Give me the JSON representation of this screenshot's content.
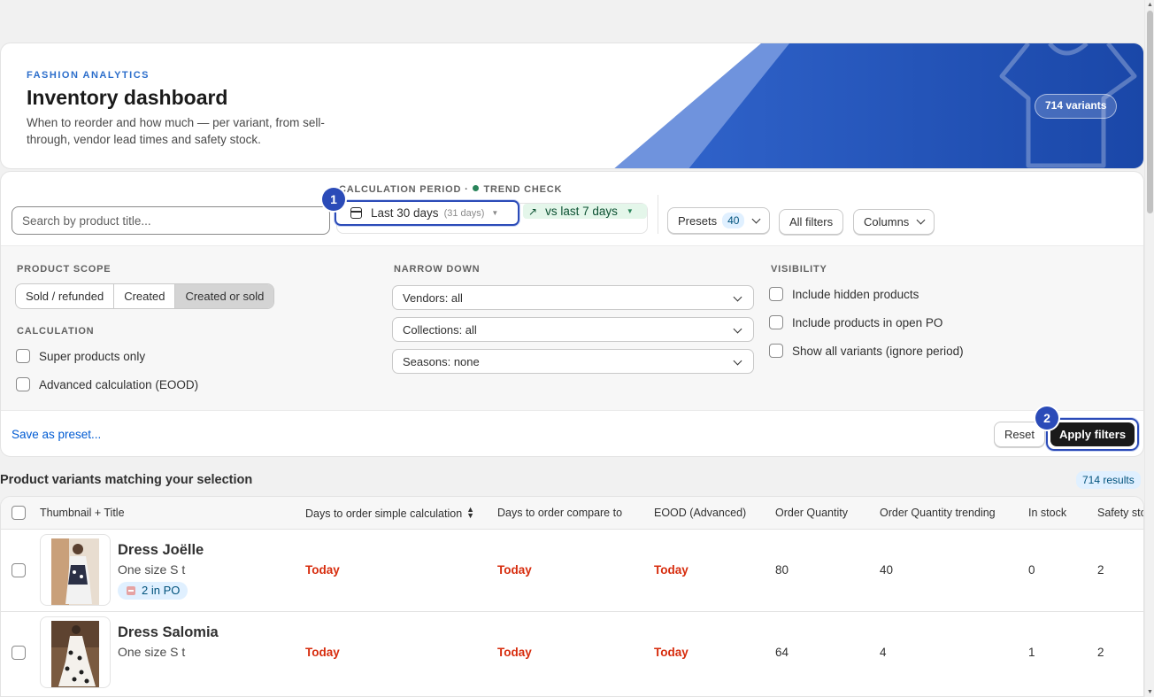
{
  "hero": {
    "eyebrow": "FASHION ANALYTICS",
    "title": "Inventory dashboard",
    "description": "When to reorder and how much — per variant, from sell-through, vendor lead times and safety stock.",
    "variants_pill": "714 variants"
  },
  "toolbar": {
    "search_placeholder": "Search by product title...",
    "calc_label": "CALCULATION PERIOD",
    "calc_separator": "·",
    "trend_label": "TREND CHECK",
    "period": "Last 30 days",
    "period_days": "(31 days)",
    "trend": "vs last 7 days",
    "presets_label": "Presets",
    "presets_count": "40",
    "all_filters": "All filters",
    "columns": "Columns"
  },
  "step_badges": {
    "one": "1",
    "two": "2"
  },
  "filters": {
    "product_scope_label": "PRODUCT SCOPE",
    "scope_options": [
      "Sold / refunded",
      "Created",
      "Created or sold"
    ],
    "scope_selected": "Created or sold",
    "calculation_label": "CALCULATION",
    "calc_options": [
      "Super products only",
      "Advanced calculation (EOOD)"
    ],
    "narrow_label": "NARROW DOWN",
    "vendors": "Vendors: all",
    "collections": "Collections: all",
    "seasons": "Seasons: none",
    "visibility_label": "VISIBILITY",
    "visibility_options": [
      "Include hidden products",
      "Include products in open PO",
      "Show all variants (ignore period)"
    ]
  },
  "actions": {
    "save_preset": "Save as preset...",
    "reset": "Reset",
    "apply": "Apply filters"
  },
  "results": {
    "title": "Product variants matching your selection",
    "count": "714 results",
    "columns": [
      "Thumbnail + Title",
      "Days to order simple calculation",
      "Days to order compare to",
      "EOOD (Advanced)",
      "Order Quantity",
      "Order Quantity trending",
      "In stock",
      "Safety sto"
    ],
    "rows": [
      {
        "name": "Dress Joëlle",
        "variant": "One size S t",
        "po_badge": "2 in PO",
        "days_simple": "Today",
        "days_compare": "Today",
        "eood": "Today",
        "order_qty": "80",
        "order_qty_trending": "40",
        "in_stock": "0",
        "safety_stock": "2"
      },
      {
        "name": "Dress Salomia",
        "variant": "One size S t",
        "po_badge": "",
        "days_simple": "Today",
        "days_compare": "Today",
        "eood": "Today",
        "order_qty": "64",
        "order_qty_trending": "4",
        "in_stock": "1",
        "safety_stock": "2"
      }
    ]
  },
  "colors": {
    "accent": "#2b4bb8",
    "danger": "#d72c0d",
    "link": "#005bd3",
    "hero_blue": "#1e4fb0"
  }
}
